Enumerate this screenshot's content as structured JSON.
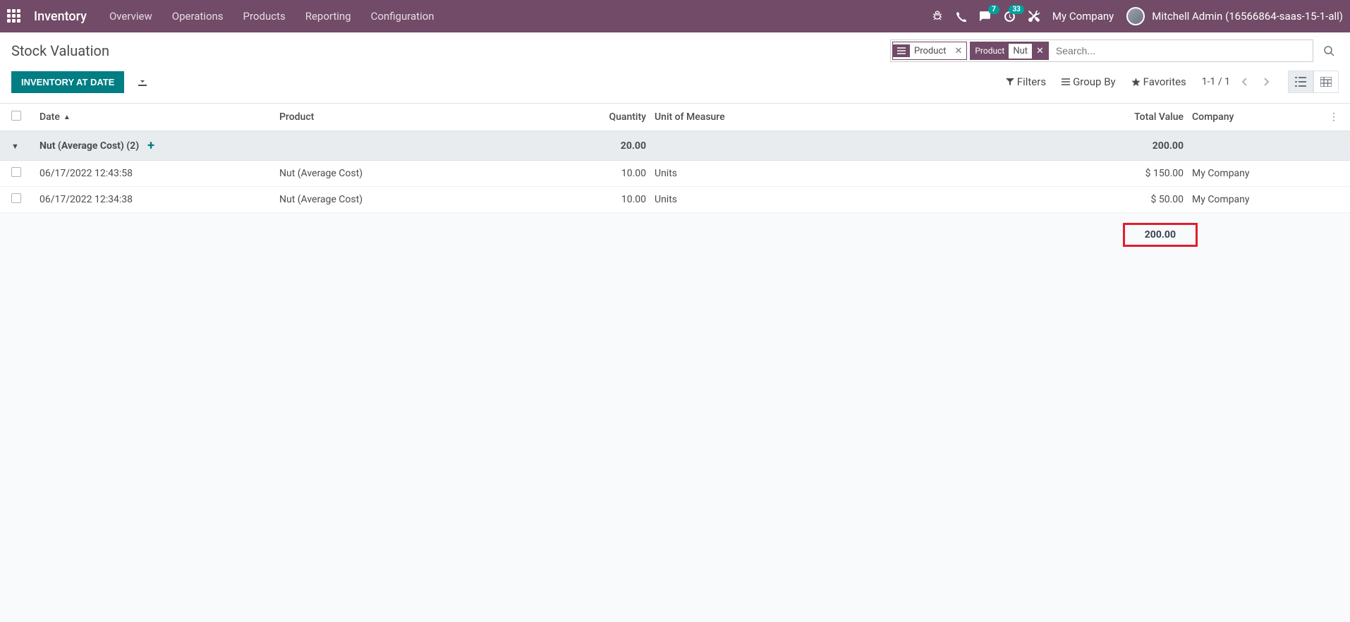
{
  "navbar": {
    "app_title": "Inventory",
    "menu": [
      "Overview",
      "Operations",
      "Products",
      "Reporting",
      "Configuration"
    ],
    "messages_badge": "7",
    "activities_badge": "33",
    "company": "My Company",
    "user": "Mitchell Admin (16566864-saas-15-1-all)"
  },
  "breadcrumb": {
    "title": "Stock Valuation"
  },
  "search": {
    "facet_group": "Product",
    "facet_key": "Product",
    "facet_value": "Nut",
    "placeholder": "Search..."
  },
  "actions": {
    "inventory_at_date": "INVENTORY AT DATE"
  },
  "toolbar": {
    "filters": "Filters",
    "group_by": "Group By",
    "favorites": "Favorites",
    "pager": "1-1 / 1"
  },
  "columns": {
    "date": "Date",
    "product": "Product",
    "quantity": "Quantity",
    "uom": "Unit of Measure",
    "total_value": "Total Value",
    "company": "Company"
  },
  "group": {
    "label": "Nut (Average Cost) (2)",
    "quantity": "20.00",
    "total": "200.00"
  },
  "rows": [
    {
      "date": "06/17/2022 12:43:58",
      "product": "Nut (Average Cost)",
      "qty": "10.00",
      "uom": "Units",
      "total": "$ 150.00",
      "company": "My Company"
    },
    {
      "date": "06/17/2022 12:34:38",
      "product": "Nut (Average Cost)",
      "qty": "10.00",
      "uom": "Units",
      "total": "$ 50.00",
      "company": "My Company"
    }
  ],
  "footer": {
    "total": "200.00"
  }
}
